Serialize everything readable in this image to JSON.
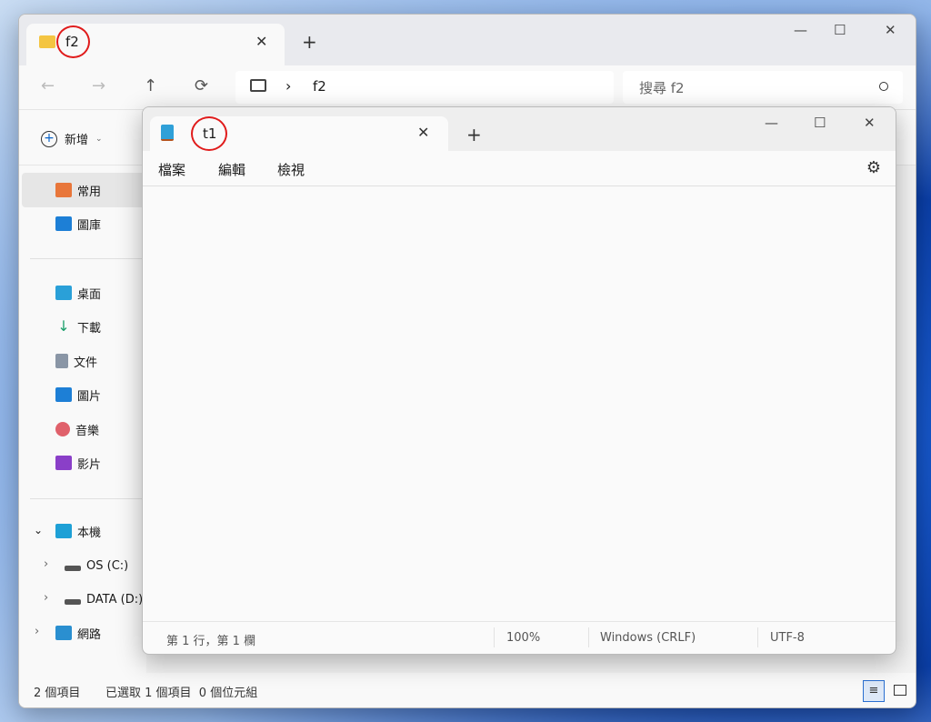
{
  "explorer": {
    "tab_title": "f2",
    "new_tab": "+",
    "close_tab": "✕",
    "window_controls": {
      "minimize": "—",
      "maximize": "☐",
      "close": "✕"
    },
    "nav": {
      "back": "←",
      "forward": "→",
      "up": "↑",
      "refresh": "⟳"
    },
    "breadcrumb": {
      "separator": "›",
      "folder": "f2"
    },
    "search_placeholder": "搜尋 f2",
    "toolbar": {
      "new_label": "新增"
    },
    "sidebar": {
      "quick": [
        {
          "label": "常用"
        },
        {
          "label": "圖庫"
        }
      ],
      "pinned": [
        {
          "label": "桌面"
        },
        {
          "label": "下載"
        },
        {
          "label": "文件"
        },
        {
          "label": "圖片"
        },
        {
          "label": "音樂"
        },
        {
          "label": "影片"
        }
      ],
      "this_pc": "本機",
      "drives": [
        {
          "label": "OS (C:)"
        },
        {
          "label": "DATA (D:)"
        }
      ],
      "network": "網路"
    },
    "status": {
      "count": "2 個項目",
      "selected": "已選取 1 個項目  0 個位元組"
    }
  },
  "notepad": {
    "tab_title": "t1",
    "new_tab": "+",
    "close_tab": "✕",
    "window_controls": {
      "minimize": "—",
      "maximize": "☐",
      "close": "✕"
    },
    "menu": [
      "檔案",
      "編輯",
      "檢視"
    ],
    "settings": "⚙",
    "content": "",
    "status": {
      "position": "第 1 行，第 1 欄",
      "zoom": "100%",
      "line_ending": "Windows (CRLF)",
      "encoding": "UTF-8"
    }
  }
}
